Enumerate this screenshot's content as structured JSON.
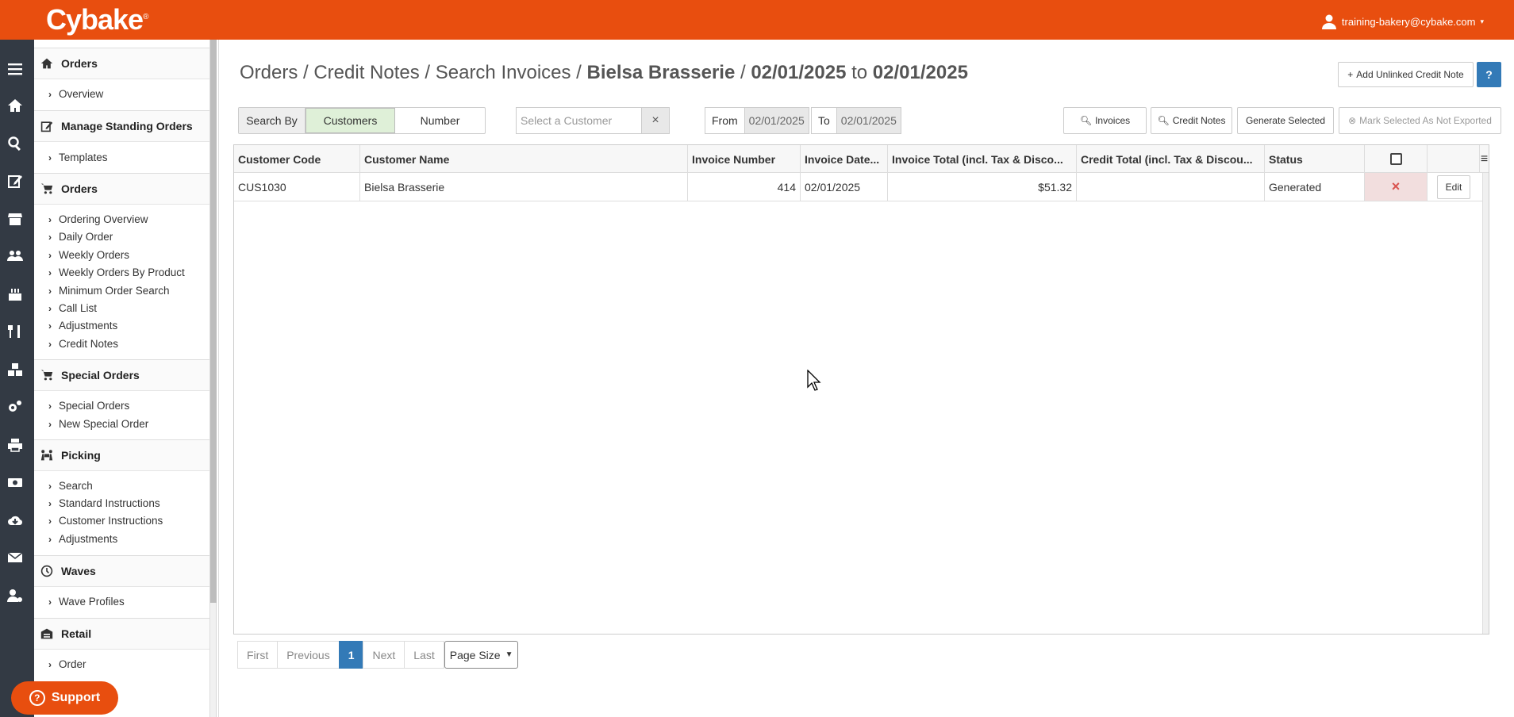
{
  "header": {
    "logo": "Cybake",
    "user": "training-bakery@cybake.com"
  },
  "sidebar": {
    "sections": [
      {
        "title": "Orders",
        "items": [
          "Overview"
        ]
      },
      {
        "title": "Manage Standing Orders",
        "items": [
          "Templates"
        ]
      },
      {
        "title": "Orders",
        "items": [
          "Ordering Overview",
          "Daily Order",
          "Weekly Orders",
          "Weekly Orders By Product",
          "Minimum Order Search",
          "Call List",
          "Adjustments",
          "Credit Notes"
        ]
      },
      {
        "title": "Special Orders",
        "items": [
          "Special Orders",
          "New Special Order"
        ]
      },
      {
        "title": "Picking",
        "items": [
          "Search",
          "Standard Instructions",
          "Customer Instructions",
          "Adjustments"
        ]
      },
      {
        "title": "Waves",
        "items": [
          "Wave Profiles"
        ]
      },
      {
        "title": "Retail",
        "items": [
          "Order"
        ]
      }
    ]
  },
  "page": {
    "breadcrumb_prefix": "Orders / Credit Notes / Search Invoices / ",
    "customer": "Bielsa Brasserie",
    "sep": " / ",
    "date_from": "02/01/2025",
    "to_word": " to ",
    "date_to": "02/01/2025",
    "add_unlinked": "Add Unlinked Credit Note",
    "help": "?"
  },
  "filters": {
    "search_by": "Search By",
    "customers": "Customers",
    "number": "Number",
    "customer_placeholder": "Select a Customer",
    "clear": "×",
    "from_label": "From",
    "from_value": "02/01/2025",
    "to_label": "To",
    "to_value": "02/01/2025",
    "invoices_btn": "Invoices",
    "credit_notes_btn": "Credit Notes",
    "generate_btn": "Generate Selected",
    "mark_btn": "Mark Selected As Not Exported"
  },
  "table": {
    "columns": [
      "Customer Code",
      "Customer Name",
      "Invoice Number",
      "Invoice Date...",
      "Invoice Total (incl. Tax & Disco...",
      "Credit Total (incl. Tax & Discou...",
      "Status"
    ],
    "rows": [
      {
        "code": "CUS1030",
        "name": "Bielsa Brasserie",
        "number": "414",
        "date": "02/01/2025",
        "total": "$51.32",
        "credit": "",
        "status": "Generated",
        "edit": "Edit",
        "remove": "×"
      }
    ]
  },
  "pager": {
    "first": "First",
    "previous": "Previous",
    "current": "1",
    "next": "Next",
    "last": "Last",
    "page_size": "Page Size"
  },
  "support": "Support"
}
